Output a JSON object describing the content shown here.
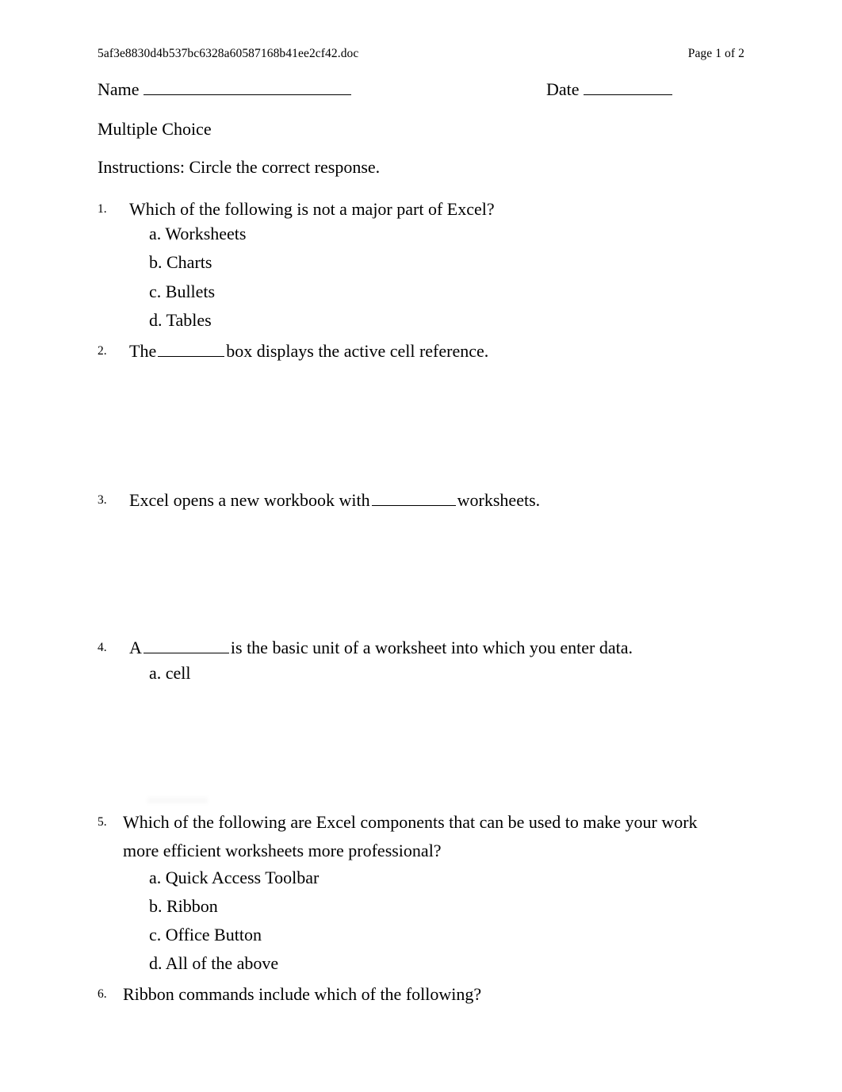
{
  "header": {
    "filename": "5af3e8830d4b537bc6328a60587168b41ee2cf42.doc",
    "page_label": "Page 1 of 2"
  },
  "fields": {
    "name_label": "Name",
    "date_label": "Date",
    "name_value": "",
    "date_value": ""
  },
  "section": {
    "heading": "Multiple Choice",
    "instructions": "Instructions: Circle the correct response."
  },
  "questions": [
    {
      "number": "1.",
      "text": "Which of the following is not a major part of Excel?",
      "options": [
        "a. Worksheets",
        "b. Charts",
        "c. Bullets",
        "d. Tables"
      ]
    },
    {
      "number": "2.",
      "text_before": "The",
      "text_after": "box displays the active cell reference.",
      "options": []
    },
    {
      "number": "3.",
      "text_before": "Excel opens a new workbook with",
      "text_after": "worksheets.",
      "options": []
    },
    {
      "number": "4.",
      "text_before": "A",
      "text_after": "is the basic unit of a worksheet into which you enter data.",
      "options": [
        "a. cell"
      ]
    },
    {
      "number": "5.",
      "text": "Which of the following are Excel components that can be used to make your work more efficient worksheets more professional?",
      "options": [
        "a. Quick Access Toolbar",
        "b. Ribbon",
        "c. Office Button",
        "d. All of the above"
      ]
    },
    {
      "number": "6.",
      "text": "Ribbon commands include which of the following?",
      "options": []
    }
  ]
}
